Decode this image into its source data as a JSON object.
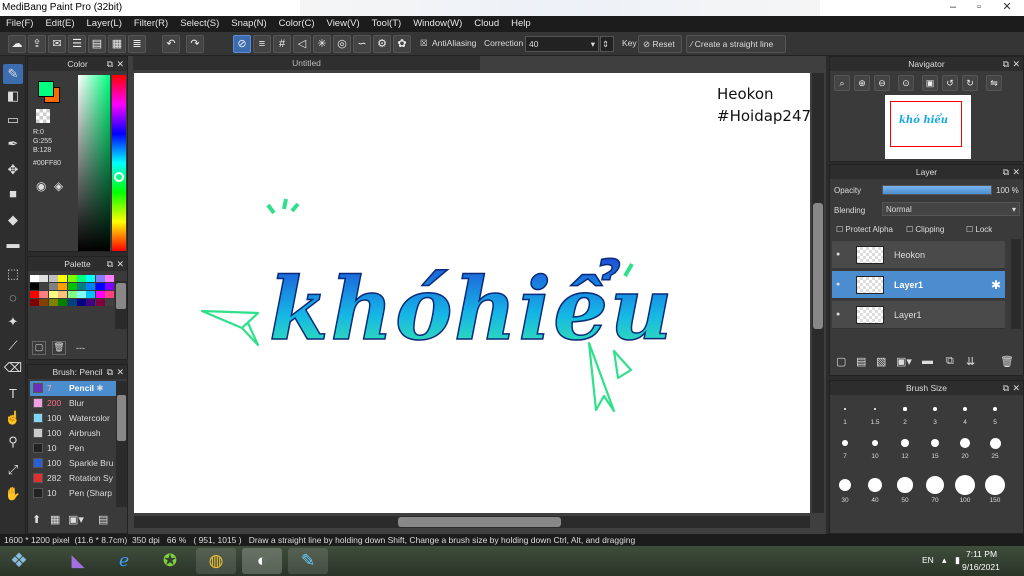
{
  "window": {
    "title": "MediBang Paint Pro (32bit)",
    "minimize": "–",
    "maximize": "▫",
    "close": "✕"
  },
  "menu": [
    "File(F)",
    "Edit(E)",
    "Layer(L)",
    "Filter(R)",
    "Select(S)",
    "Snap(N)",
    "Color(C)",
    "View(V)",
    "Tool(T)",
    "Window(W)",
    "Cloud",
    "Help"
  ],
  "toolbar": {
    "antialiasing": "AntiAliasing",
    "correction_label": "Correction",
    "correction_value": "40",
    "key_label": "Key",
    "reset_label": "Reset",
    "straight_line_label": "Create a straight line"
  },
  "color_panel": {
    "title": "Color",
    "r": "R:0",
    "g": "G:255",
    "b": "B:128",
    "hex": "#00FF80",
    "fg_color": "#00FF80",
    "bg_color": "#ff6a00"
  },
  "palette_panel": {
    "title": "Palette",
    "dash": "---"
  },
  "brush_panel": {
    "title": "Brush: Pencil",
    "items": [
      {
        "size": "7",
        "name": "Pencil",
        "color": "#6b2fb8"
      },
      {
        "size": "200",
        "name": "Blur",
        "color": "#f0a0e0"
      },
      {
        "size": "100",
        "name": "Watercolor",
        "color": "#7fd8f0"
      },
      {
        "size": "100",
        "name": "Airbrush",
        "color": "#cccccc"
      },
      {
        "size": "10",
        "name": "Pen",
        "color": "#222222"
      },
      {
        "size": "100",
        "name": "Sparkle Bru",
        "color": "#2a5fd6"
      },
      {
        "size": "282",
        "name": "Rotation Sy",
        "color": "#e03030"
      },
      {
        "size": "10",
        "name": "Pen (Sharp",
        "color": "#222222"
      }
    ]
  },
  "canvas": {
    "tab_title": "Untitled",
    "note_line1": "Heokon",
    "note_line2": "#Hoidap247",
    "word1": "khó",
    "word2": "hiểu"
  },
  "navigator": {
    "title": "Navigator",
    "thumb_text": "khó hiểu"
  },
  "layer_panel": {
    "title": "Layer",
    "opacity_label": "Opacity",
    "opacity_value": "100 %",
    "opacity_level": 1.0,
    "blending_label": "Blending",
    "blending_value": "Normal",
    "protect_alpha": "Protect Alpha",
    "clipping": "Clipping",
    "lock": "Lock",
    "layers": [
      {
        "name": "Heokon",
        "selected": false
      },
      {
        "name": "Layer1",
        "selected": true
      },
      {
        "name": "Layer1",
        "selected": false
      }
    ]
  },
  "brush_size_panel": {
    "title": "Brush Size",
    "sizes": [
      "1",
      "1.5",
      "2",
      "3",
      "4",
      "5",
      "7",
      "10",
      "12",
      "15",
      "20",
      "25",
      "30",
      "40",
      "50",
      "70",
      "100",
      "150"
    ]
  },
  "status": {
    "dimensions": "1600 * 1200 pixel",
    "physical": "(11.6 * 8.7cm)",
    "dpi": "350 dpi",
    "zoom": "66 %",
    "coords": "( 951, 1015 )",
    "hint": "Draw a straight line by holding down Shift, Change a brush size by holding down Ctrl, Alt, and dragging"
  },
  "taskbar": {
    "lang": "EN",
    "time": "7:11 PM",
    "date": "9/16/2021"
  }
}
